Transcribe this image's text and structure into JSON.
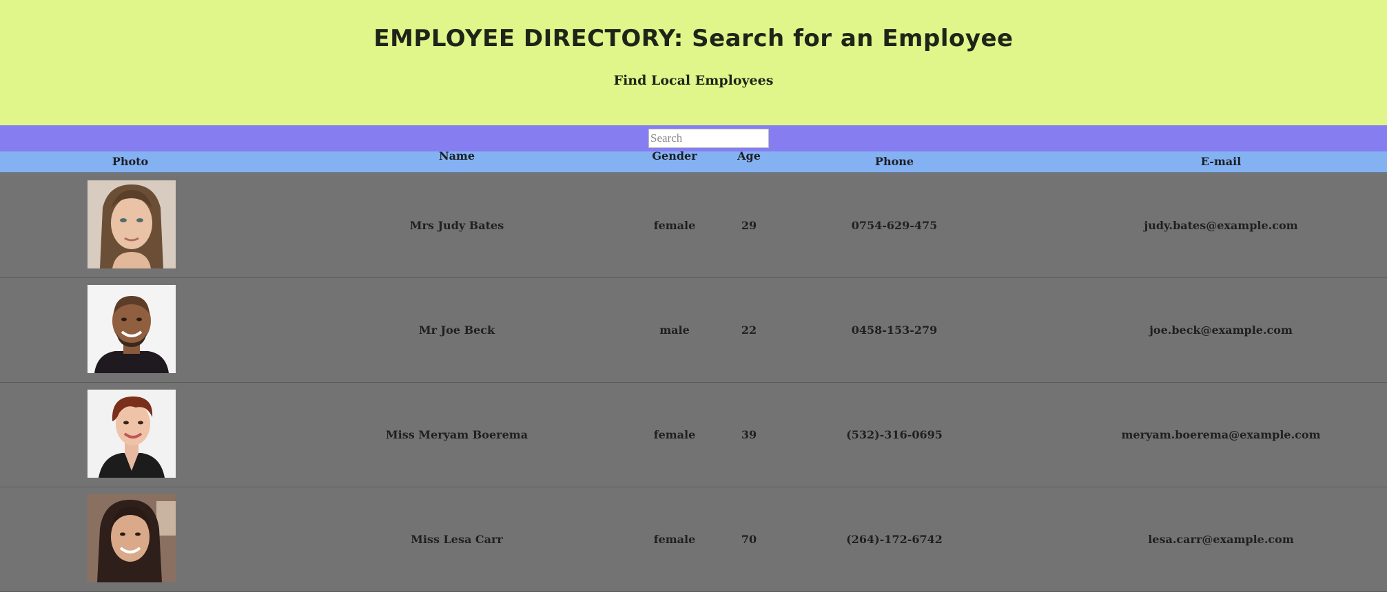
{
  "header": {
    "title": "EMPLOYEE DIRECTORY: Search for an Employee",
    "subtitle": "Find Local Employees",
    "background": "#e0f68a"
  },
  "search": {
    "placeholder": "Search",
    "value": "",
    "background": "#867ef0"
  },
  "table": {
    "header_background": "#83b1f2",
    "row_background": "#737373",
    "columns": [
      "Photo",
      "Name",
      "Gender",
      "Age",
      "Phone",
      "E-mail"
    ],
    "rows": [
      {
        "name": "Mrs Judy Bates",
        "gender": "female",
        "age": "29",
        "phone": "0754-629-475",
        "email": "judy.bates@example.com",
        "photo": "woman-long-straight-hair"
      },
      {
        "name": "Mr Joe Beck",
        "gender": "male",
        "age": "22",
        "phone": "0458-153-279",
        "email": "joe.beck@example.com",
        "photo": "man-bald-smiling"
      },
      {
        "name": "Miss Meryam Boerema",
        "gender": "female",
        "age": "39",
        "phone": "(532)-316-0695",
        "email": "meryam.boerema@example.com",
        "photo": "woman-short-red-hair"
      },
      {
        "name": "Miss Lesa Carr",
        "gender": "female",
        "age": "70",
        "phone": "(264)-172-6742",
        "email": "lesa.carr@example.com",
        "photo": "woman-long-dark-hair"
      }
    ]
  }
}
